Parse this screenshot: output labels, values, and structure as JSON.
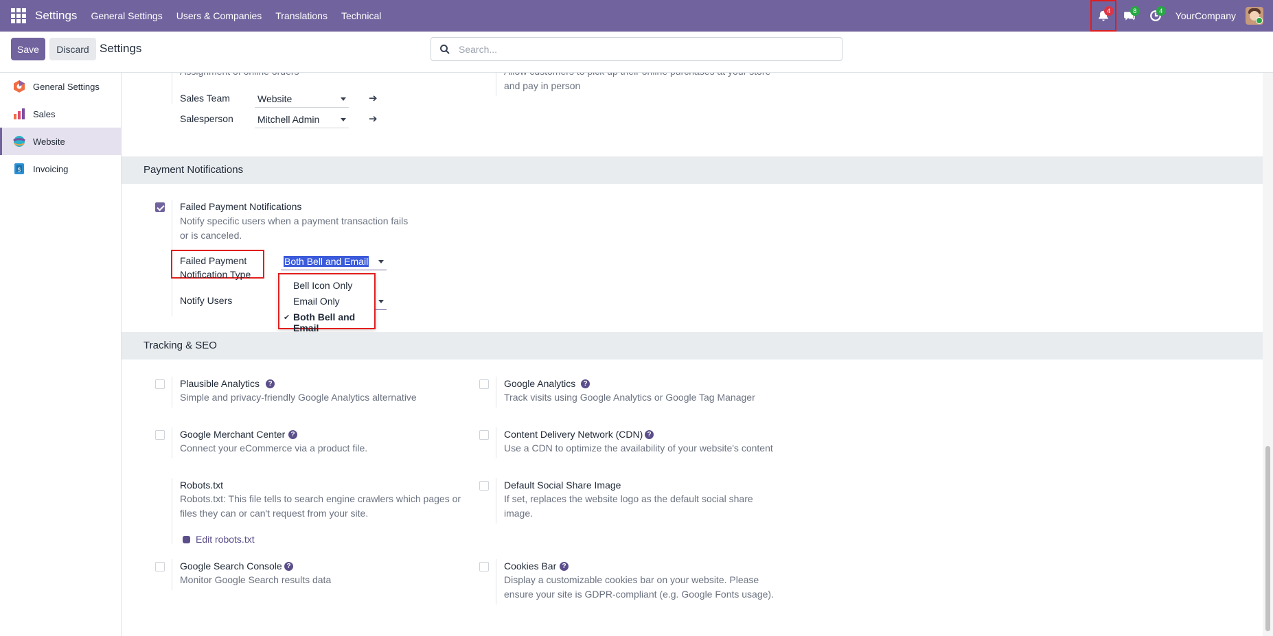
{
  "navbar": {
    "brand": "Settings",
    "menu": [
      "General Settings",
      "Users & Companies",
      "Translations",
      "Technical"
    ],
    "activity_badge": "4",
    "messages_badge": "8",
    "activities_badge": "4",
    "company": "YourCompany"
  },
  "control": {
    "save_label": "Save",
    "discard_label": "Discard",
    "title": "Settings",
    "search_placeholder": "Search..."
  },
  "sidebar": {
    "items": [
      {
        "label": "General Settings"
      },
      {
        "label": "Sales"
      },
      {
        "label": "Website"
      },
      {
        "label": "Invoicing"
      }
    ]
  },
  "orders": {
    "assign_desc": "Assignment of online orders",
    "sales_team_label": "Sales Team",
    "sales_team_value": "Website",
    "salesperson_label": "Salesperson",
    "salesperson_value": "Mitchell Admin",
    "pickup_desc": "Allow customers to pick up their online purchases at your store and pay in person"
  },
  "payment": {
    "section_title": "Payment Notifications",
    "failed_title": "Failed Payment Notifications",
    "failed_desc": "Notify specific users when a payment transaction fails or is canceled.",
    "type_label": "Failed Payment Notification Type",
    "type_value": "Both Bell and Email",
    "notify_users_label": "Notify Users",
    "options": [
      "Bell Icon Only",
      "Email Only",
      "Both Bell and Email"
    ]
  },
  "tracking": {
    "section_title": "Tracking & SEO",
    "plausible_title": "Plausible Analytics",
    "plausible_desc": "Simple and privacy-friendly Google Analytics alternative",
    "ga_title": "Google Analytics",
    "ga_desc": "Track visits using Google Analytics or Google Tag Manager",
    "gmc_title": "Google Merchant Center",
    "gmc_desc": "Connect your eCommerce via a product file.",
    "cdn_title": "Content Delivery Network (CDN)",
    "cdn_desc": "Use a CDN to optimize the availability of your website's content",
    "robots_title": "Robots.txt",
    "robots_desc": "Robots.txt: This file tells to search engine crawlers which pages or files they can or can't request from your site.",
    "robots_link": "Edit robots.txt",
    "social_title": "Default Social Share Image",
    "social_desc": "If set, replaces the website logo as the default social share image.",
    "gsc_title": "Google Search Console",
    "gsc_desc": "Monitor Google Search results data",
    "cookies_title": "Cookies Bar",
    "cookies_desc": "Display a customizable cookies bar on your website. Please ensure your site is GDPR-compliant (e.g. Google Fonts usage)."
  }
}
